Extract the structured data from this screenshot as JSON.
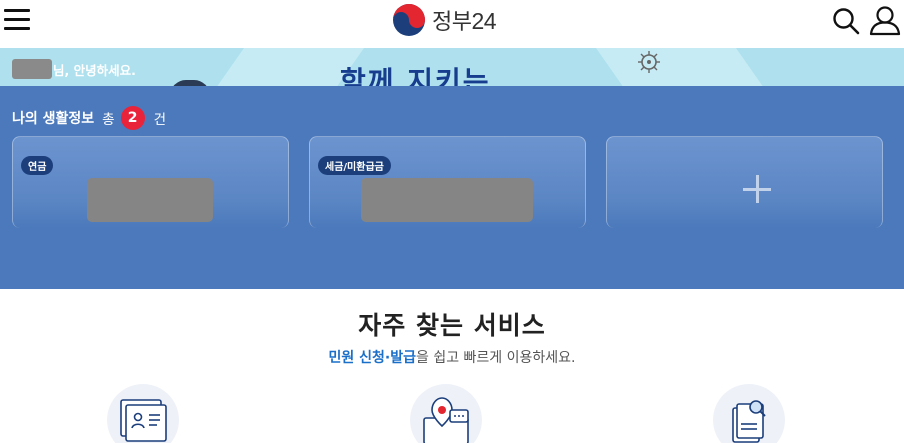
{
  "header": {
    "logo_text": "정부",
    "logo_num": "24"
  },
  "banner": {
    "greeting": "님, 안녕하세요.",
    "title": "함께 지키는"
  },
  "life_info": {
    "title": "나의 생활정보",
    "total_label": "총",
    "count": "2",
    "unit": "건",
    "cards": [
      {
        "tag": "연금"
      },
      {
        "tag": "세금/미환급금"
      }
    ]
  },
  "services": {
    "title": "자주 찾는 서비스",
    "subtitle_highlight": "민원 신청·발급",
    "subtitle_rest": "을 쉽고 빠르게 이용하세요."
  },
  "icons": {
    "menu": "hamburger-menu-icon",
    "search": "search-icon",
    "user": "user-icon",
    "add": "plus-icon"
  },
  "colors": {
    "panel": "#4b79bb",
    "badge": "#e8233a",
    "highlight": "#1a6fc9",
    "banner": "#aee0ee"
  }
}
